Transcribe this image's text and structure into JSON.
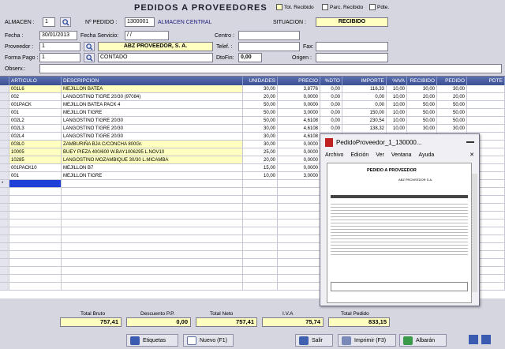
{
  "title": "PEDIDOS A PROVEEDORES",
  "status_checks": [
    {
      "label": "Tot. Recibido"
    },
    {
      "label": "Parc. Recibido"
    },
    {
      "label": "Pdte."
    }
  ],
  "header": {
    "almacen_label": "ALMACEN :",
    "almacen_value": "1",
    "pedido_label": "Nº PEDIDO :",
    "pedido_value": "1300001",
    "almacen_name": "ALMACEN CENTRAL",
    "situacion_label": "SITUACION :",
    "situacion_value": "RECIBIDO",
    "fecha_label": "Fecha :",
    "fecha_value": "30/01/2013",
    "fecha_servicio_label": "Fecha Servicio:",
    "fecha_servicio_value": "/ /",
    "centro_label": "Centro :",
    "proveedor_label": "Proveedor :",
    "proveedor_value": "1",
    "proveedor_name": "ABZ PROVEEDOR, S. A.",
    "telef_label": "Telef. :",
    "fax_label": "Fax:",
    "forma_pago_label": "Forma Pago :",
    "forma_pago_value": "1",
    "forma_pago_name": "CONTADO",
    "dtofin_label": "DtoFin:",
    "dtofin_value": "0,00",
    "origen_label": "Origen :",
    "observ_label": "Observ.:"
  },
  "grid": {
    "columns": [
      "ARTICULO",
      "DESCRIPCION",
      "UNIDADES",
      "PRECIO",
      "%DTO",
      "IMPORTE",
      "%IVA",
      "RECIBIDO",
      "PEDIDO",
      "PDTE"
    ],
    "rows": [
      {
        "art": "001L6",
        "desc": "MEJILLON BATEA",
        "uds": "30,00",
        "precio": "3,8776",
        "dto": "0,00",
        "imp": "116,33",
        "iva": "10,00",
        "rec": "30,00",
        "ped": "30,00",
        "pdte": "",
        "hl": true
      },
      {
        "art": "002",
        "desc": "LANGOSTINO TIGRE 20/30 (97084)",
        "uds": "20,00",
        "precio": "0,0000",
        "dto": "0,00",
        "imp": "0,00",
        "iva": "10,00",
        "rec": "20,00",
        "ped": "20,00",
        "pdte": "",
        "hl": false
      },
      {
        "art": "001PACK",
        "desc": "MEJILLON BATEA   PACK 4",
        "uds": "50,00",
        "precio": "0,0000",
        "dto": "0,00",
        "imp": "0,00",
        "iva": "10,00",
        "rec": "50,00",
        "ped": "50,00",
        "pdte": "",
        "hl": false
      },
      {
        "art": "001",
        "desc": "MEJILLON TIGRE",
        "uds": "50,00",
        "precio": "3,0000",
        "dto": "0,00",
        "imp": "150,00",
        "iva": "10,00",
        "rec": "50,00",
        "ped": "50,00",
        "pdte": "",
        "hl": false
      },
      {
        "art": "002L2",
        "desc": "LANGOSTINO TIGRE 20/30",
        "uds": "50,00",
        "precio": "4,6108",
        "dto": "0,00",
        "imp": "230,54",
        "iva": "10,00",
        "rec": "50,00",
        "ped": "50,00",
        "pdte": "",
        "hl": false
      },
      {
        "art": "002L3",
        "desc": "LANGOSTINO TIGRE 20/30",
        "uds": "30,00",
        "precio": "4,6108",
        "dto": "0,00",
        "imp": "138,32",
        "iva": "10,00",
        "rec": "30,00",
        "ped": "30,00",
        "pdte": "",
        "hl": false
      },
      {
        "art": "002L4",
        "desc": "LANGOSTINO TIGRE 20/30",
        "uds": "30,00",
        "precio": "4,6108",
        "dto": "",
        "imp": "",
        "iva": "",
        "rec": "",
        "ped": "",
        "pdte": "",
        "hl": false
      },
      {
        "art": "003L0",
        "desc": "ZAMBURIÑA BJA C/CONCHA 800Gr.",
        "uds": "30,00",
        "precio": "0,0000",
        "dto": "",
        "imp": "",
        "iva": "",
        "rec": "",
        "ped": "",
        "pdte": "",
        "hl": true
      },
      {
        "art": "10005",
        "desc": "BUEY PIEZA 400/600 W.BAY1006295 L.NOV10",
        "uds": "25,00",
        "precio": "0,0000",
        "dto": "",
        "imp": "",
        "iva": "",
        "rec": "",
        "ped": "",
        "pdte": "",
        "hl": true
      },
      {
        "art": "10285",
        "desc": "LANGOSTINO MOZAMBIQUE 30/30 L.MICAMBA",
        "uds": "20,00",
        "precio": "0,0000",
        "dto": "",
        "imp": "",
        "iva": "",
        "rec": "",
        "ped": "",
        "pdte": "",
        "hl": true
      },
      {
        "art": "001PACK10",
        "desc": "MEJILLON B7",
        "uds": "15,00",
        "precio": "0,0000",
        "dto": "",
        "imp": "",
        "iva": "",
        "rec": "",
        "ped": "",
        "pdte": "",
        "hl": false
      },
      {
        "art": "001",
        "desc": "MEJILLON TIGRE",
        "uds": "10,00",
        "precio": "3,0000",
        "dto": "",
        "imp": "",
        "iva": "",
        "rec": "",
        "ped": "",
        "pdte": "",
        "hl": false
      }
    ],
    "new_row_marker": "*"
  },
  "totals": {
    "bruto_label": "Total Bruto",
    "bruto": "757,41",
    "dpp_label": "Descuento P.P.",
    "dpp": "0,00",
    "neto_label": "Total Neto",
    "neto": "757,41",
    "iva_label": "I.V.A",
    "iva": "75,74",
    "pedido_label": "Total Pedido",
    "pedido": "833,15"
  },
  "buttons": {
    "etiquetas": "Etiquetas",
    "nuevo": "Nuevo (F1)",
    "salir": "Salir",
    "imprimir": "Imprimir (F3)",
    "albaran": "Albarán"
  },
  "preview": {
    "title": "PedidoProveedor_1_130000...",
    "menu": [
      "Archivo",
      "Edición",
      "Ver",
      "Ventana",
      "Ayuda"
    ],
    "doc_title": "PEDIDO A PROVEEDOR",
    "doc_supplier": "ABZ PROVEEDOR S.A."
  },
  "colors": {
    "header_grid": "#3b4f93",
    "highlight": "#ffffc0",
    "background": "#d6d6e0"
  }
}
